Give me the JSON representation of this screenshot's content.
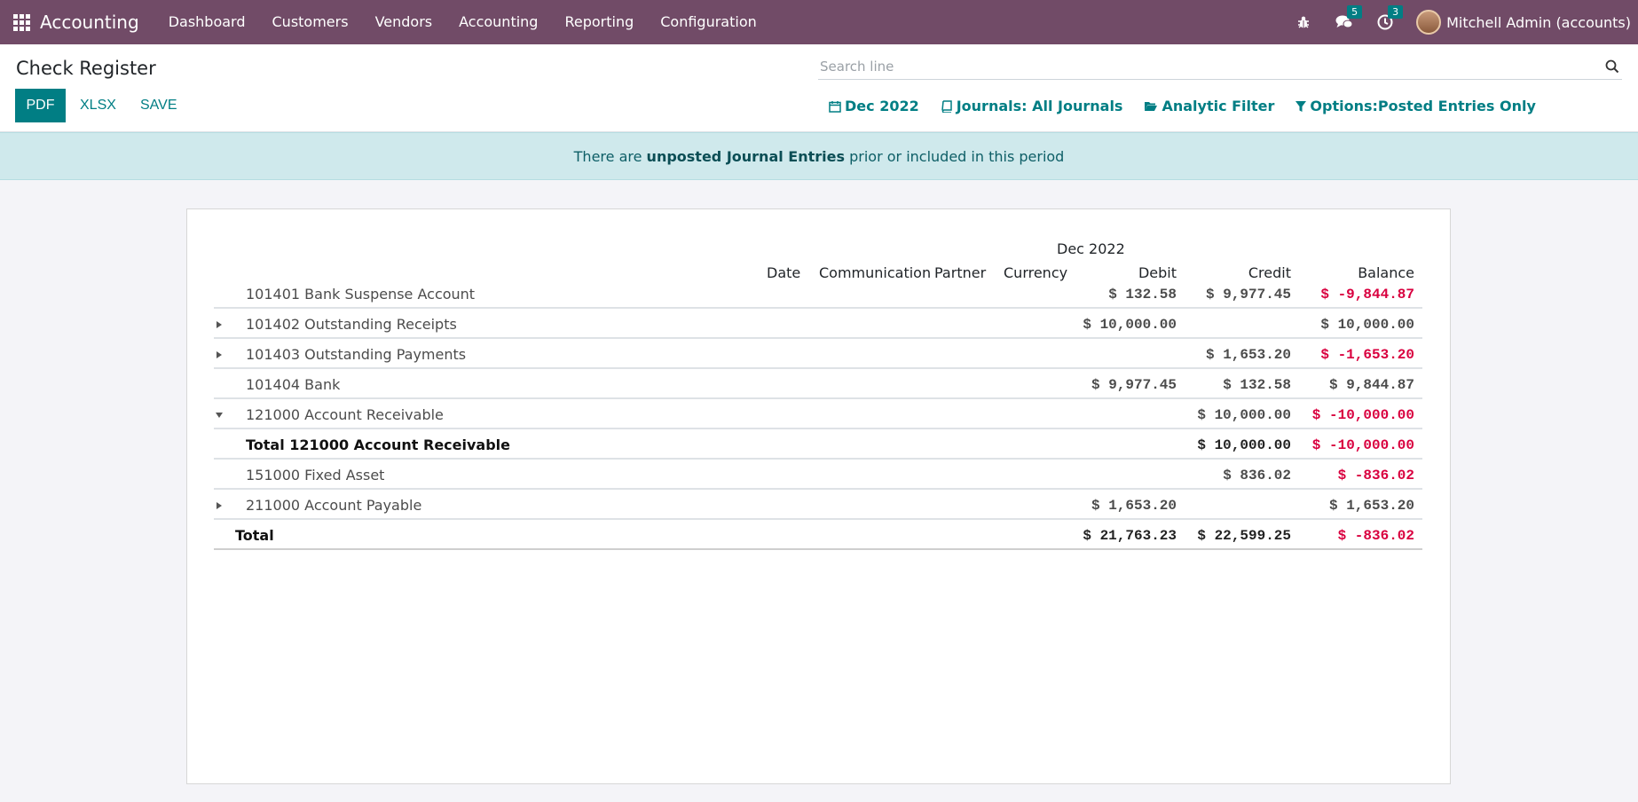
{
  "navbar": {
    "app_name": "Accounting",
    "menu": [
      "Dashboard",
      "Customers",
      "Vendors",
      "Accounting",
      "Reporting",
      "Configuration"
    ],
    "messages_count": "5",
    "activities_count": "3",
    "user": "Mitchell Admin (accounts)",
    "color": "#714b67"
  },
  "control": {
    "title": "Check Register",
    "buttons": {
      "pdf": "PDF",
      "xlsx": "XLSX",
      "save": "SAVE"
    },
    "search_placeholder": "Search line",
    "filters": {
      "date": "Dec 2022",
      "journals": "Journals: All Journals",
      "analytic": "Analytic Filter",
      "options": "Options:Posted Entries Only"
    },
    "accent": "#017e84"
  },
  "alert": {
    "prefix": "There are ",
    "link": "unposted Journal Entries",
    "suffix": " prior or included in this period"
  },
  "report": {
    "period": "Dec 2022",
    "columns": [
      "Date",
      "Communication",
      "Partner",
      "Currency",
      "Debit",
      "Credit",
      "Balance"
    ],
    "rows": [
      {
        "label": "101401 Bank Suspense Account",
        "caret": "",
        "debit": "$ 132.58",
        "credit": "$ 9,977.45",
        "balance": "$ -9,844.87",
        "negative": true
      },
      {
        "label": "101402 Outstanding Receipts",
        "caret": "right",
        "debit": "$ 10,000.00",
        "credit": "",
        "balance": "$ 10,000.00",
        "negative": false
      },
      {
        "label": "101403 Outstanding Payments",
        "caret": "right",
        "debit": "",
        "credit": "$ 1,653.20",
        "balance": "$ -1,653.20",
        "negative": true
      },
      {
        "label": "101404 Bank",
        "caret": "",
        "debit": "$ 9,977.45",
        "credit": "$ 132.58",
        "balance": "$ 9,844.87",
        "negative": false
      },
      {
        "label": "121000 Account Receivable",
        "caret": "down",
        "debit": "",
        "credit": "$ 10,000.00",
        "balance": "$ -10,000.00",
        "negative": true
      },
      {
        "label": "Total 121000 Account Receivable",
        "caret": "",
        "debit": "",
        "credit": "$ 10,000.00",
        "balance": "$ -10,000.00",
        "negative": true,
        "bold": true
      },
      {
        "label": "151000 Fixed Asset",
        "caret": "",
        "debit": "",
        "credit": "$ 836.02",
        "balance": "$ -836.02",
        "negative": true
      },
      {
        "label": "211000 Account Payable",
        "caret": "right",
        "debit": "$ 1,653.20",
        "credit": "",
        "balance": "$ 1,653.20",
        "negative": false
      }
    ],
    "total": {
      "label": "Total",
      "debit": "$ 21,763.23",
      "credit": "$ 22,599.25",
      "balance": "$ -836.02"
    },
    "negative_color": "#d9003f"
  }
}
